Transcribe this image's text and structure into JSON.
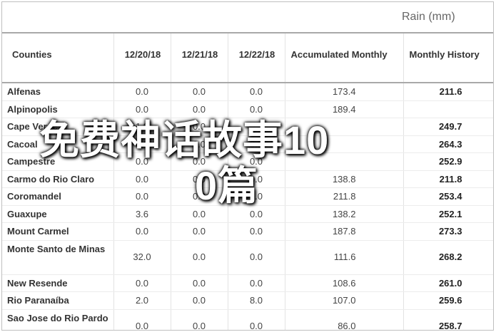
{
  "header": {
    "rain_label": "Rain (mm)"
  },
  "columns": [
    "Counties",
    "12/20/18",
    "12/21/18",
    "12/22/18",
    "Accumulated Monthly",
    "Monthly History"
  ],
  "rows": [
    {
      "name": "Alfenas",
      "d1": "0.0",
      "d2": "0.0",
      "d3": "0.0",
      "acc": "173.4",
      "hist": "211.6"
    },
    {
      "name": "Alpinopolis",
      "d1": "0.0",
      "d2": "0.0",
      "d3": "0.0",
      "acc": "189.4",
      "hist": ""
    },
    {
      "name": "Cape Verde",
      "d1": "1.0",
      "d2": "0.0",
      "d3": "0.0",
      "acc": "",
      "hist": "249.7"
    },
    {
      "name": "Cacoal",
      "d1": "0.0",
      "d2": "0.0",
      "d3": "0.0",
      "acc": "",
      "hist": "264.3"
    },
    {
      "name": "Campestre",
      "d1": "0.0",
      "d2": "0.0",
      "d3": "0.0",
      "acc": "",
      "hist": "252.9"
    },
    {
      "name": "Carmo do Rio Claro",
      "d1": "0.0",
      "d2": "0.0",
      "d3": "0.0",
      "acc": "138.8",
      "hist": "211.8"
    },
    {
      "name": "Coromandel",
      "d1": "0.0",
      "d2": "0.0",
      "d3": "0.0",
      "acc": "211.8",
      "hist": "253.4"
    },
    {
      "name": "Guaxupe",
      "d1": "3.6",
      "d2": "0.0",
      "d3": "0.0",
      "acc": "138.2",
      "hist": "252.1"
    },
    {
      "name": "Mount Carmel",
      "d1": "0.0",
      "d2": "0.0",
      "d3": "0.0",
      "acc": "187.8",
      "hist": "273.3"
    },
    {
      "name": "Monte Santo de Minas",
      "d1": "32.0",
      "d2": "0.0",
      "d3": "0.0",
      "acc": "111.6",
      "hist": "268.2"
    },
    {
      "name": "New Resende",
      "d1": "0.0",
      "d2": "0.0",
      "d3": "0.0",
      "acc": "108.6",
      "hist": "261.0"
    },
    {
      "name": "Rio Paranaíba",
      "d1": "2.0",
      "d2": "0.0",
      "d3": "8.0",
      "acc": "107.0",
      "hist": "259.6"
    },
    {
      "name": "Sao Jose do Rio Pardo",
      "d1": "0.0",
      "d2": "0.0",
      "d3": "0.0",
      "acc": "86.0",
      "hist": "258.7"
    }
  ],
  "watermark": {
    "line1": "免费神话故事10",
    "line2": "0篇"
  }
}
